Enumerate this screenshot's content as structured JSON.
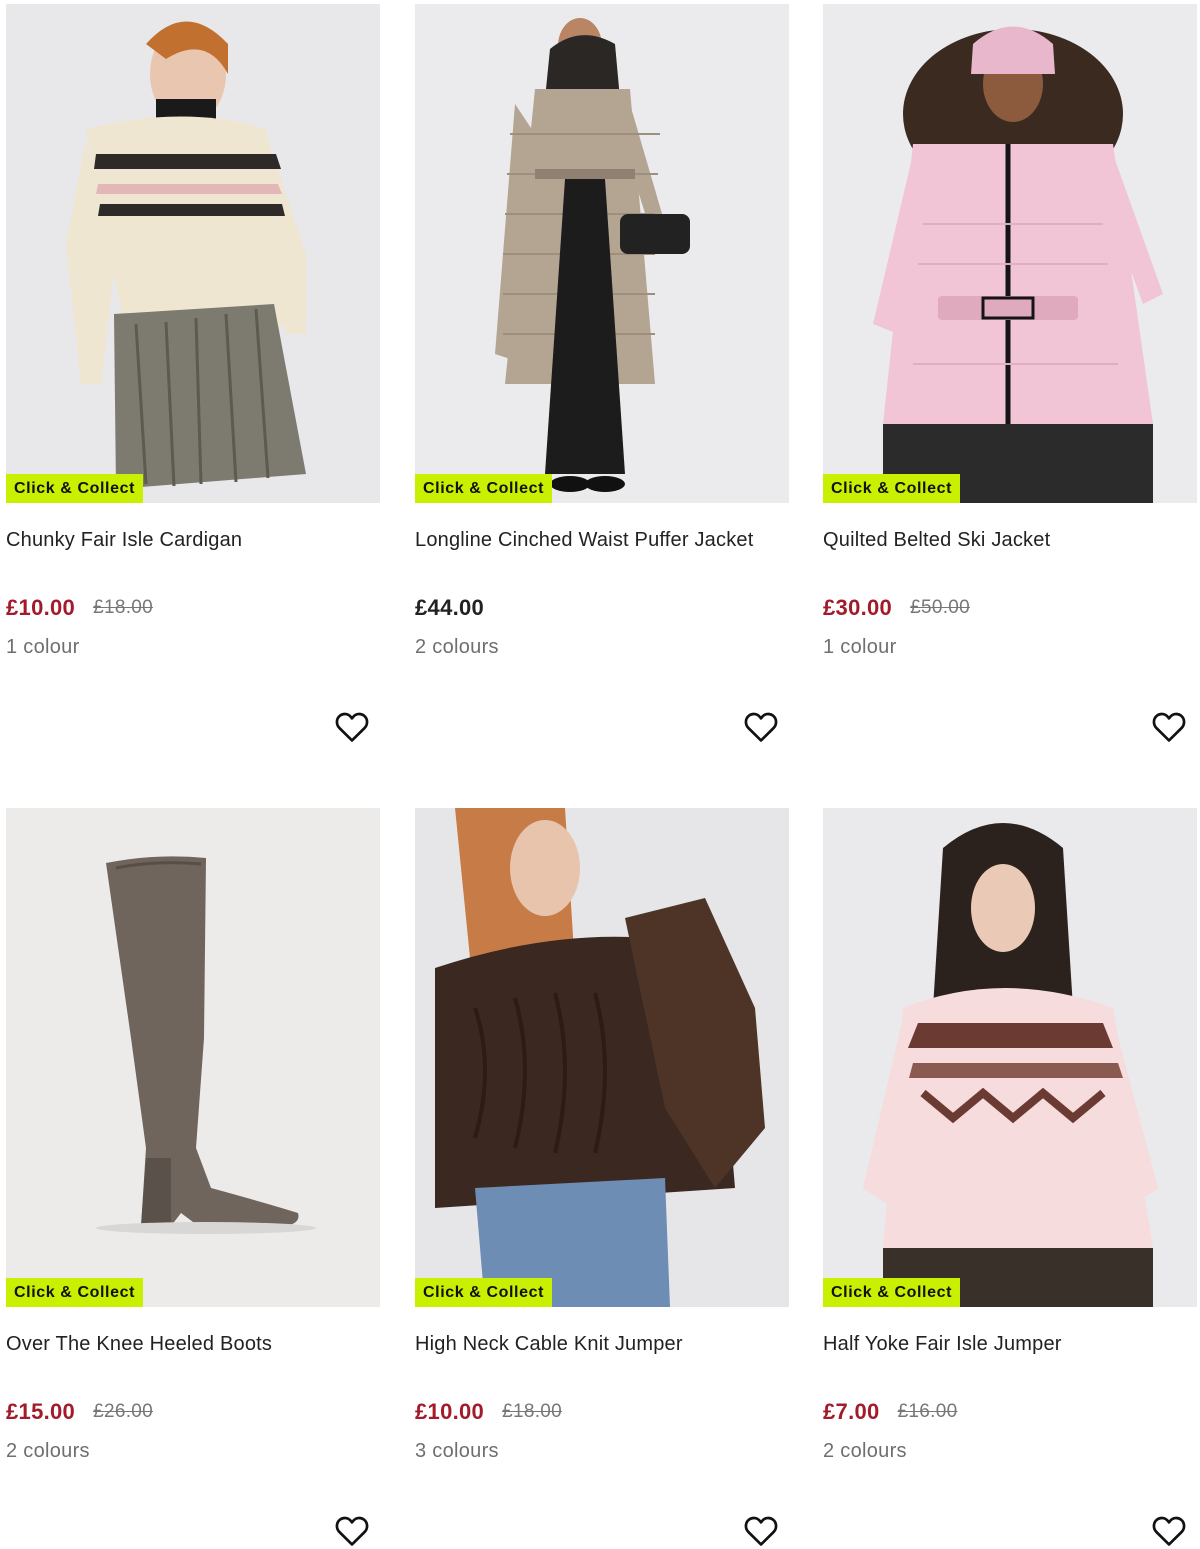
{
  "badge_color": "#c8f000",
  "sale_color": "#a31b2a",
  "products": [
    {
      "name": "Chunky Fair Isle Cardigan",
      "badge": "Click & Collect",
      "price": "£10.00",
      "was_price": "£18.00",
      "on_sale": true,
      "colours": "1 colour",
      "image": "cream-fair-isle-cardigan-photo",
      "wishlist_icon": "heart-outline-icon"
    },
    {
      "name": "Longline Cinched Waist Puffer Jacket",
      "badge": "Click & Collect",
      "price": "£44.00",
      "was_price": "",
      "on_sale": false,
      "colours": "2 colours",
      "image": "beige-long-puffer-jacket-photo",
      "wishlist_icon": "heart-outline-icon"
    },
    {
      "name": "Quilted Belted Ski Jacket",
      "badge": "Click & Collect",
      "price": "£30.00",
      "was_price": "£50.00",
      "on_sale": true,
      "colours": "1 colour",
      "image": "pink-belted-ski-jacket-photo",
      "wishlist_icon": "heart-outline-icon"
    },
    {
      "name": "Over The Knee Heeled Boots",
      "badge": "Click & Collect",
      "price": "£15.00",
      "was_price": "£26.00",
      "on_sale": true,
      "colours": "2 colours",
      "image": "grey-suede-over-knee-boot-photo",
      "wishlist_icon": "heart-outline-icon"
    },
    {
      "name": "High Neck Cable Knit Jumper",
      "badge": "Click & Collect",
      "price": "£10.00",
      "was_price": "£18.00",
      "on_sale": true,
      "colours": "3 colours",
      "image": "brown-cable-knit-jumper-photo",
      "wishlist_icon": "heart-outline-icon"
    },
    {
      "name": "Half Yoke Fair Isle Jumper",
      "badge": "Click & Collect",
      "price": "£7.00",
      "was_price": "£16.00",
      "on_sale": true,
      "colours": "2 colours",
      "image": "pink-fair-isle-jumper-photo",
      "wishlist_icon": "heart-outline-icon"
    }
  ]
}
